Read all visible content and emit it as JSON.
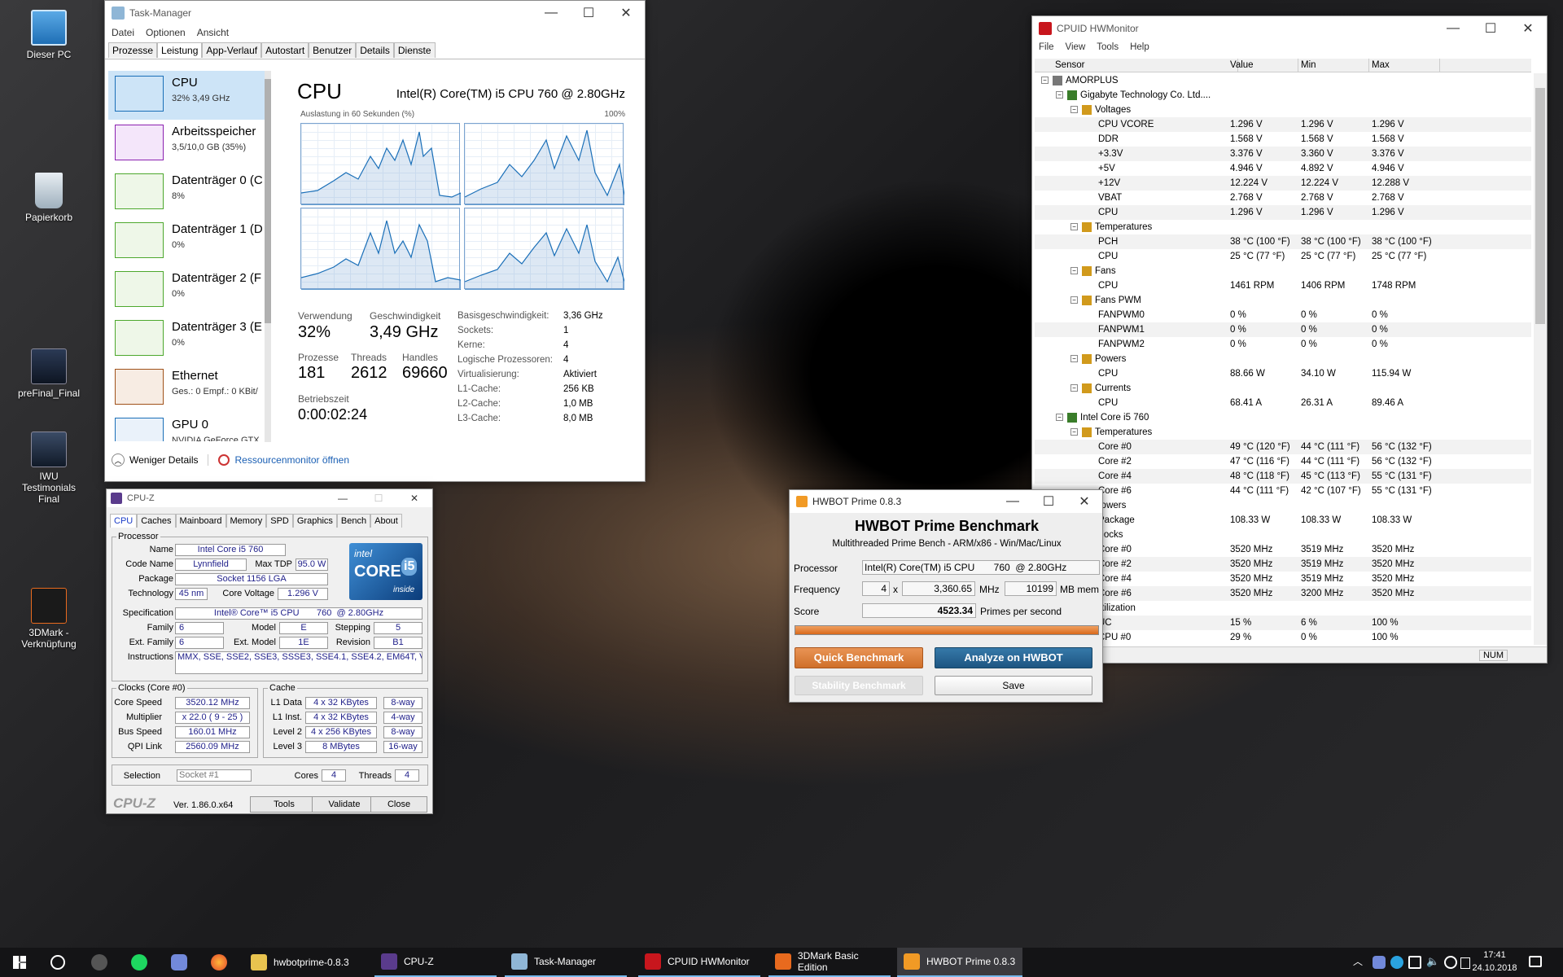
{
  "desktop": {
    "icons": [
      {
        "label": "Dieser PC"
      },
      {
        "label": "Papierkorb"
      },
      {
        "label": "preFinal_Final"
      },
      {
        "label": "IWU Testimonials Final"
      },
      {
        "label": "3DMark - Verknüpfung"
      }
    ]
  },
  "taskmanager": {
    "title": "Task-Manager",
    "menu": [
      "Datei",
      "Optionen",
      "Ansicht"
    ],
    "tabs": [
      "Prozesse",
      "Leistung",
      "App-Verlauf",
      "Autostart",
      "Benutzer",
      "Details",
      "Dienste"
    ],
    "side": [
      {
        "name": "CPU",
        "sub": "32% 3,49 GHz"
      },
      {
        "name": "Arbeitsspeicher",
        "sub": "3,5/10,0 GB (35%)"
      },
      {
        "name": "Datenträger 0 (C",
        "sub": "8%"
      },
      {
        "name": "Datenträger 1 (D",
        "sub": "0%"
      },
      {
        "name": "Datenträger 2 (F",
        "sub": "0%"
      },
      {
        "name": "Datenträger 3 (E",
        "sub": "0%"
      },
      {
        "name": "Ethernet",
        "sub": "Ges.: 0 Empf.: 0 KBit/"
      },
      {
        "name": "GPU 0",
        "sub": "NVIDIA GeForce GTX"
      }
    ],
    "heading": "CPU",
    "model": "Intel(R) Core(TM) i5 CPU 760 @ 2.80GHz",
    "util_label": "Auslastung in 60 Sekunden (%)",
    "util_max": "100%",
    "stats": {
      "usage_l": "Verwendung",
      "usage": "32%",
      "speed_l": "Geschwindigkeit",
      "speed": "3,49 GHz",
      "proc_l": "Prozesse",
      "proc": "181",
      "threads_l": "Threads",
      "threads": "2612",
      "handles_l": "Handles",
      "handles": "69660",
      "uptime_l": "Betriebszeit",
      "uptime": "0:00:02:24"
    },
    "details": [
      [
        "Basisgeschwindigkeit:",
        "3,36 GHz"
      ],
      [
        "Sockets:",
        "1"
      ],
      [
        "Kerne:",
        "4"
      ],
      [
        "Logische Prozessoren:",
        "4"
      ],
      [
        "Virtualisierung:",
        "Aktiviert"
      ],
      [
        "L1-Cache:",
        "256 KB"
      ],
      [
        "L2-Cache:",
        "1,0 MB"
      ],
      [
        "L3-Cache:",
        "8,0 MB"
      ]
    ],
    "fewer": "Weniger Details",
    "resmon": "Ressourcenmonitor öffnen"
  },
  "cpuz": {
    "title": "CPU-Z",
    "tabs": [
      "CPU",
      "Caches",
      "Mainboard",
      "Memory",
      "SPD",
      "Graphics",
      "Bench",
      "About"
    ],
    "proc_group": "Processor",
    "name_l": "Name",
    "name": "Intel Core i5 760",
    "code_l": "Code Name",
    "code": "Lynnfield",
    "tdp_l": "Max TDP",
    "tdp": "95.0 W",
    "pkg_l": "Package",
    "pkg": "Socket 1156 LGA",
    "tech_l": "Technology",
    "tech": "45 nm",
    "volt_l": "Core Voltage",
    "volt": "1.296 V",
    "spec_l": "Specification",
    "spec": "Intel® Core™ i5 CPU       760  @ 2.80GHz",
    "fam_l": "Family",
    "fam": "6",
    "model_l": "Model",
    "model": "E",
    "step_l": "Stepping",
    "step": "5",
    "efam_l": "Ext. Family",
    "efam": "6",
    "emod_l": "Ext. Model",
    "emod": "1E",
    "rev_l": "Revision",
    "rev": "B1",
    "instr_l": "Instructions",
    "instr": "MMX, SSE, SSE2, SSE3, SSSE3, SSE4.1, SSE4.2, EM64T, VT-x",
    "clocks_group": "Clocks (Core #0)",
    "cs_l": "Core Speed",
    "cs": "3520.12 MHz",
    "mul_l": "Multiplier",
    "mul": "x 22.0 ( 9 - 25 )",
    "bus_l": "Bus Speed",
    "bus": "160.01 MHz",
    "qpi_l": "QPI Link",
    "qpi": "2560.09 MHz",
    "cache_group": "Cache",
    "l1d_l": "L1 Data",
    "l1d": "4 x 32 KBytes",
    "l1d_w": "8-way",
    "l1i_l": "L1 Inst.",
    "l1i": "4 x 32 KBytes",
    "l1i_w": "4-way",
    "l2_l": "Level 2",
    "l2": "4 x 256 KBytes",
    "l2_w": "8-way",
    "l3_l": "Level 3",
    "l3": "8 MBytes",
    "l3_w": "16-way",
    "sel_l": "Selection",
    "sel": "Socket #1",
    "cores_l": "Cores",
    "cores": "4",
    "thr_l": "Threads",
    "thr": "4",
    "brand": "CPU-Z",
    "ver": "Ver. 1.86.0.x64",
    "tools": "Tools",
    "validate": "Validate",
    "close": "Close",
    "logo1": "intel",
    "logo2": "CORE",
    "logo3": "i5",
    "logo4": "inside"
  },
  "hwmon": {
    "title": "CPUID HWMonitor",
    "menu": [
      "File",
      "View",
      "Tools",
      "Help"
    ],
    "cols": [
      "Sensor",
      "Value",
      "Min",
      "Max"
    ],
    "rows": [
      {
        "i": 0,
        "n": "AMORPLUS",
        "v": "",
        "mn": "",
        "mx": ""
      },
      {
        "i": 1,
        "n": "Gigabyte Technology Co. Ltd....",
        "v": "",
        "mn": "",
        "mx": ""
      },
      {
        "i": 2,
        "n": "Voltages",
        "v": "",
        "mn": "",
        "mx": ""
      },
      {
        "i": 3,
        "n": "CPU VCORE",
        "v": "1.296 V",
        "mn": "1.296 V",
        "mx": "1.296 V"
      },
      {
        "i": 3,
        "n": "DDR",
        "v": "1.568 V",
        "mn": "1.568 V",
        "mx": "1.568 V"
      },
      {
        "i": 3,
        "n": "+3.3V",
        "v": "3.376 V",
        "mn": "3.360 V",
        "mx": "3.376 V"
      },
      {
        "i": 3,
        "n": "+5V",
        "v": "4.946 V",
        "mn": "4.892 V",
        "mx": "4.946 V"
      },
      {
        "i": 3,
        "n": "+12V",
        "v": "12.224 V",
        "mn": "12.224 V",
        "mx": "12.288 V"
      },
      {
        "i": 3,
        "n": "VBAT",
        "v": "2.768 V",
        "mn": "2.768 V",
        "mx": "2.768 V"
      },
      {
        "i": 3,
        "n": "CPU",
        "v": "1.296 V",
        "mn": "1.296 V",
        "mx": "1.296 V"
      },
      {
        "i": 2,
        "n": "Temperatures",
        "v": "",
        "mn": "",
        "mx": ""
      },
      {
        "i": 3,
        "n": "PCH",
        "v": "38 °C  (100 °F)",
        "mn": "38 °C  (100 °F)",
        "mx": "38 °C  (100 °F)"
      },
      {
        "i": 3,
        "n": "CPU",
        "v": "25 °C  (77 °F)",
        "mn": "25 °C  (77 °F)",
        "mx": "25 °C  (77 °F)"
      },
      {
        "i": 2,
        "n": "Fans",
        "v": "",
        "mn": "",
        "mx": ""
      },
      {
        "i": 3,
        "n": "CPU",
        "v": "1461 RPM",
        "mn": "1406 RPM",
        "mx": "1748 RPM"
      },
      {
        "i": 2,
        "n": "Fans PWM",
        "v": "",
        "mn": "",
        "mx": ""
      },
      {
        "i": 3,
        "n": "FANPWM0",
        "v": "0 %",
        "mn": "0 %",
        "mx": "0 %"
      },
      {
        "i": 3,
        "n": "FANPWM1",
        "v": "0 %",
        "mn": "0 %",
        "mx": "0 %"
      },
      {
        "i": 3,
        "n": "FANPWM2",
        "v": "0 %",
        "mn": "0 %",
        "mx": "0 %"
      },
      {
        "i": 2,
        "n": "Powers",
        "v": "",
        "mn": "",
        "mx": ""
      },
      {
        "i": 3,
        "n": "CPU",
        "v": "88.66 W",
        "mn": "34.10 W",
        "mx": "115.94 W"
      },
      {
        "i": 2,
        "n": "Currents",
        "v": "",
        "mn": "",
        "mx": ""
      },
      {
        "i": 3,
        "n": "CPU",
        "v": "68.41 A",
        "mn": "26.31 A",
        "mx": "89.46 A"
      },
      {
        "i": 1,
        "n": "Intel Core i5 760",
        "v": "",
        "mn": "",
        "mx": ""
      },
      {
        "i": 2,
        "n": "Temperatures",
        "v": "",
        "mn": "",
        "mx": ""
      },
      {
        "i": 3,
        "n": "Core #0",
        "v": "49 °C  (120 °F)",
        "mn": "44 °C  (111 °F)",
        "mx": "56 °C  (132 °F)"
      },
      {
        "i": 3,
        "n": "Core #2",
        "v": "47 °C  (116 °F)",
        "mn": "44 °C  (111 °F)",
        "mx": "56 °C  (132 °F)"
      },
      {
        "i": 3,
        "n": "Core #4",
        "v": "48 °C  (118 °F)",
        "mn": "45 °C  (113 °F)",
        "mx": "55 °C  (131 °F)"
      },
      {
        "i": 3,
        "n": "Core #6",
        "v": "44 °C  (111 °F)",
        "mn": "42 °C  (107 °F)",
        "mx": "55 °C  (131 °F)"
      },
      {
        "i": 2,
        "n": "Powers",
        "v": "",
        "mn": "",
        "mx": ""
      },
      {
        "i": 3,
        "n": "Package",
        "v": "108.33 W",
        "mn": "108.33 W",
        "mx": "108.33 W"
      },
      {
        "i": 2,
        "n": "Clocks",
        "v": "",
        "mn": "",
        "mx": ""
      },
      {
        "i": 3,
        "n": "Core #0",
        "v": "3520 MHz",
        "mn": "3519 MHz",
        "mx": "3520 MHz"
      },
      {
        "i": 3,
        "n": "Core #2",
        "v": "3520 MHz",
        "mn": "3519 MHz",
        "mx": "3520 MHz"
      },
      {
        "i": 3,
        "n": "Core #4",
        "v": "3520 MHz",
        "mn": "3519 MHz",
        "mx": "3520 MHz"
      },
      {
        "i": 3,
        "n": "Core #6",
        "v": "3520 MHz",
        "mn": "3200 MHz",
        "mx": "3520 MHz"
      },
      {
        "i": 2,
        "n": "Utilization",
        "v": "",
        "mn": "",
        "mx": ""
      },
      {
        "i": 3,
        "n": "UC",
        "v": "15 %",
        "mn": "6 %",
        "mx": "100 %"
      },
      {
        "i": 3,
        "n": "CPU #0",
        "v": "29 %",
        "mn": "0 %",
        "mx": "100 %"
      }
    ],
    "status": "NUM"
  },
  "hwbot": {
    "title": "HWBOT Prime 0.8.3",
    "heading": "HWBOT Prime Benchmark",
    "sub": "Multithreaded Prime Bench - ARM/x86 - Win/Mac/Linux",
    "proc_l": "Processor",
    "proc": "Intel(R) Core(TM) i5 CPU       760  @ 2.80GHz",
    "freq_l": "Frequency",
    "freq_n": "4",
    "x": "x",
    "freq": "3,360.65",
    "mhz": "MHz",
    "mem": "10199",
    "mbmem": "MB mem",
    "score_l": "Score",
    "score": "4523.34",
    "pps": "Primes per second",
    "progress": 1.0,
    "quick": "Quick Benchmark",
    "analyze": "Analyze on HWBOT",
    "stability": "Stability Benchmark",
    "save": "Save"
  },
  "taskbar": {
    "items": [
      "hwbotprime-0.8.3",
      "CPU-Z",
      "Task-Manager",
      "CPUID HWMonitor",
      "3DMark Basic Edition",
      "HWBOT Prime 0.8.3"
    ],
    "time": "17:41",
    "date": "24.10.2018"
  }
}
